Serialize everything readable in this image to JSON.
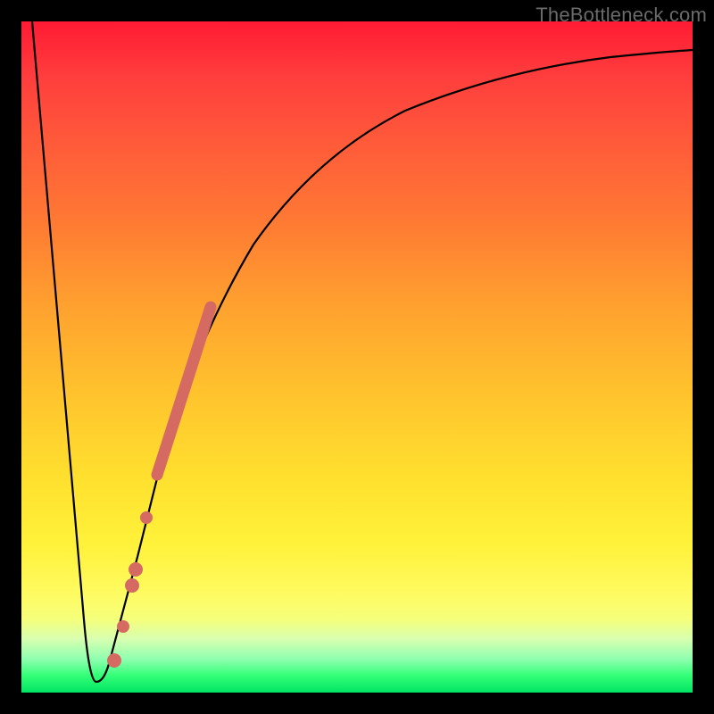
{
  "watermark": "TheBottleneck.com",
  "chart_data": {
    "type": "line",
    "title": "",
    "xlabel": "",
    "ylabel": "",
    "xlim": [
      0,
      100
    ],
    "ylim": [
      0,
      100
    ],
    "series": [
      {
        "name": "bottleneck-curve",
        "x": [
          0,
          5,
          8,
          9,
          10,
          11,
          12,
          15,
          18,
          20,
          22,
          25,
          30,
          35,
          40,
          50,
          60,
          70,
          80,
          90,
          100
        ],
        "y": [
          100,
          55,
          15,
          4,
          3,
          3,
          4,
          15,
          30,
          40,
          48,
          57,
          68,
          75,
          80,
          86,
          90,
          92.5,
          94,
          95,
          95.5
        ]
      }
    ],
    "markers": [
      {
        "name": "pink-segment",
        "x_range": [
          19,
          27
        ],
        "y_range": [
          36,
          60
        ],
        "thick": true
      },
      {
        "name": "pink-dot-1",
        "x": 17.5,
        "y": 27
      },
      {
        "name": "pink-dot-2",
        "x": 15.8,
        "y": 18
      },
      {
        "name": "pink-dot-3",
        "x": 14.5,
        "y": 12
      },
      {
        "name": "pink-dot-4",
        "x": 13.2,
        "y": 7
      }
    ],
    "colors": {
      "curve": "#000000",
      "marker": "#d46a62",
      "gradient_top": "#ff1a33",
      "gradient_bottom": "#00e463"
    }
  }
}
